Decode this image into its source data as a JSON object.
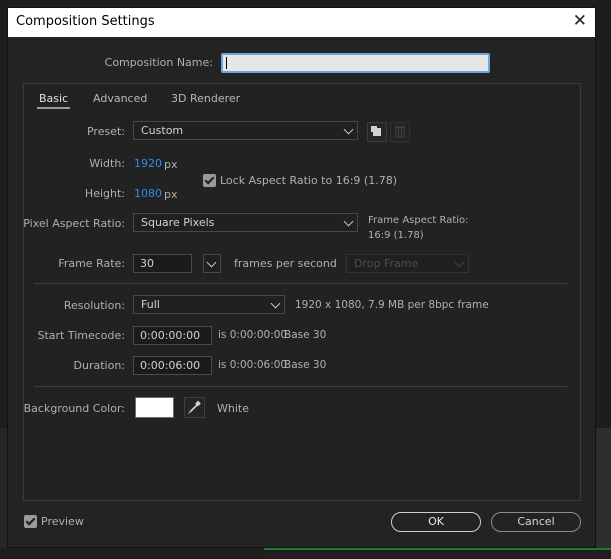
{
  "window": {
    "title": "Composition Settings",
    "close_glyph": "✕"
  },
  "comp_name": {
    "label": "Composition Name:",
    "value": ""
  },
  "tabs": [
    {
      "label": "Basic"
    },
    {
      "label": "Advanced"
    },
    {
      "label": "3D Renderer"
    }
  ],
  "preset": {
    "label": "Preset:",
    "value": "Custom"
  },
  "width": {
    "label": "Width:",
    "value": "1920",
    "unit": "px"
  },
  "height": {
    "label": "Height:",
    "value": "1080",
    "unit": "px"
  },
  "lock_aspect": {
    "label": "Lock Aspect Ratio to 16:9 (1.78)",
    "checked": true
  },
  "pixel_aspect": {
    "label": "Pixel Aspect Ratio:",
    "value": "Square Pixels"
  },
  "frame_aspect": {
    "line1": "Frame Aspect Ratio:",
    "line2": "16:9 (1.78)"
  },
  "frame_rate": {
    "label": "Frame Rate:",
    "value": "30",
    "unit": "frames per second",
    "drop_frame": "Drop Frame"
  },
  "resolution": {
    "label": "Resolution:",
    "value": "Full",
    "info": "1920 x 1080, 7.9 MB per 8bpc frame"
  },
  "start_timecode": {
    "label": "Start Timecode:",
    "value": "0:00:00:00",
    "info": "is 0:00:00:00",
    "base": "Base 30"
  },
  "duration": {
    "label": "Duration:",
    "value": "0:00:06:00",
    "info": "is 0:00:06:00",
    "base": "Base 30"
  },
  "background": {
    "label": "Background Color:",
    "color": "#ffffff",
    "name": "White"
  },
  "footer": {
    "preview_label": "Preview",
    "preview_checked": true,
    "ok_label": "OK",
    "cancel_label": "Cancel"
  },
  "colors": {
    "accent_blue": "#2d8ceb",
    "dialog_bg": "#232323",
    "title_bg": "#ffffff",
    "focus_ring": "#6fa6de"
  }
}
